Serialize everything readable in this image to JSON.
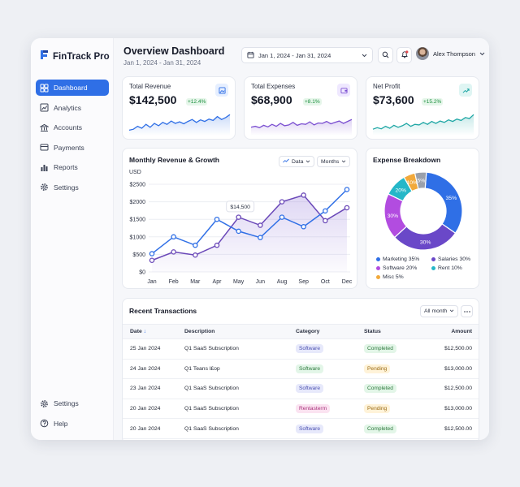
{
  "app": {
    "brand": "FinTrack Pro"
  },
  "sidebar": {
    "items": [
      {
        "label": "Dashboard",
        "icon": "dashboard-icon",
        "active": true
      },
      {
        "label": "Analytics",
        "icon": "analytics-icon"
      },
      {
        "label": "Accounts",
        "icon": "bank-icon"
      },
      {
        "label": "Payments",
        "icon": "card-icon"
      },
      {
        "label": "Reports",
        "icon": "reports-icon"
      },
      {
        "label": "Settings",
        "icon": "gear-icon"
      }
    ],
    "bottom": [
      {
        "label": "Settings",
        "icon": "gear-icon"
      },
      {
        "label": "Help",
        "icon": "help-icon"
      }
    ]
  },
  "header": {
    "title": "Overview Dashboard",
    "subtitle": "Jan 1, 2024 - Jan 31, 2024",
    "date_range": "Jan 1, 2024 - Jan 31, 2024",
    "user_name": "Alex Thompson"
  },
  "kpis": [
    {
      "label": "Total Revenue",
      "value": "$142,500",
      "change": "+12.4%",
      "color": "#2f6fe6",
      "icon": "image-icon",
      "icon_bg": "#e6efff",
      "trend": [
        0.15,
        0.2,
        0.35,
        0.25,
        0.45,
        0.3,
        0.5,
        0.38,
        0.55,
        0.45,
        0.62,
        0.5,
        0.58,
        0.48,
        0.6,
        0.7,
        0.55,
        0.68,
        0.6,
        0.72,
        0.65,
        0.85,
        0.7,
        0.8,
        0.95
      ]
    },
    {
      "label": "Total Expenses",
      "value": "$68,900",
      "change": "+8.1%",
      "color": "#7b4fd1",
      "icon": "wallet-icon",
      "icon_bg": "#efe8ff",
      "trend": [
        0.3,
        0.35,
        0.28,
        0.4,
        0.32,
        0.45,
        0.35,
        0.5,
        0.38,
        0.42,
        0.55,
        0.4,
        0.48,
        0.45,
        0.58,
        0.42,
        0.52,
        0.5,
        0.6,
        0.48,
        0.55,
        0.62,
        0.5,
        0.6,
        0.7
      ]
    },
    {
      "label": "Net Profit",
      "value": "$73,600",
      "change": "+15.2%",
      "color": "#1fa7a5",
      "icon": "trend-up-icon",
      "icon_bg": "#dff5f3",
      "trend": [
        0.2,
        0.28,
        0.22,
        0.35,
        0.25,
        0.4,
        0.3,
        0.38,
        0.5,
        0.35,
        0.45,
        0.42,
        0.55,
        0.45,
        0.6,
        0.5,
        0.62,
        0.55,
        0.68,
        0.6,
        0.72,
        0.65,
        0.8,
        0.75,
        0.95
      ]
    }
  ],
  "revenue_chart": {
    "title": "Monthly Revenue & Growth",
    "data_label": "Data",
    "period_label": "Months",
    "unit": "USD",
    "tooltip": "$14,500"
  },
  "chart_data": [
    {
      "type": "line",
      "title": "Monthly Revenue & Growth",
      "ylabel": "USD",
      "ylim": [
        0,
        2500
      ],
      "y_ticks": [
        "$0",
        "$500",
        "$1000",
        "$1500",
        "$2000",
        "$2500"
      ],
      "categories": [
        "Jan",
        "Feb",
        "Mar",
        "Apr",
        "May",
        "Jun",
        "Aug",
        "Sep",
        "Oct",
        "Dec"
      ],
      "grid": true,
      "series": [
        {
          "color": "#2f6fe6",
          "values": [
            520,
            1000,
            760,
            1500,
            1160,
            980,
            1560,
            1290,
            1740,
            2350
          ]
        },
        {
          "color": "#6a48b8",
          "values": [
            330,
            570,
            480,
            760,
            1560,
            1330,
            2000,
            2190,
            1460,
            1830
          ]
        }
      ],
      "annotation": "$14,500"
    },
    {
      "type": "pie",
      "title": "Expense Breakdown",
      "slices": [
        {
          "label": "Marketing",
          "value": 35,
          "color": "#2f6fe6",
          "display": "35%",
          "legend": "Marketing 35%"
        },
        {
          "label": "Salaries",
          "value": 30,
          "color": "#6a48c8",
          "display": "30%",
          "legend": "Salaries 30%"
        },
        {
          "label": "Software",
          "value": 20,
          "color": "#b24ce0",
          "display": "30%",
          "legend": "Software 20%"
        },
        {
          "label": "Rent",
          "value": 10,
          "color": "#25b7c8",
          "display": "20%",
          "legend": "Rent 10%"
        },
        {
          "label": "Misc",
          "value": 5,
          "color": "#f2a93b",
          "display": "10%",
          "legend": "Misc 5%"
        },
        {
          "label": "",
          "value": 5,
          "color": "#9aa0ab",
          "display": "5%"
        }
      ]
    }
  ],
  "transactions": {
    "title": "Recent Transactions",
    "filter": "All month",
    "columns": [
      "Date",
      "Description",
      "Category",
      "Status",
      "Amount"
    ],
    "rows": [
      {
        "date": "25 Jan 2024",
        "description": "Q1 SaaS Subscription",
        "category": "Software",
        "cat_color": "software",
        "status": "Completed",
        "amount": "$12,500.00"
      },
      {
        "date": "24 Jan 2024",
        "description": "Q1 Teans l£op",
        "category": "Software",
        "cat_color": "green",
        "status": "Pending",
        "amount": "$13,000.00"
      },
      {
        "date": "23 Jan 2024",
        "description": "Q1 SaaS Subscription",
        "category": "Software",
        "cat_color": "software",
        "status": "Completed",
        "amount": "$12,500.00"
      },
      {
        "date": "20 Jan 2024",
        "description": "Q1 SaaS Subscription",
        "category": "Rentasterm",
        "cat_color": "pink",
        "status": "Pending",
        "amount": "$13,000.00"
      },
      {
        "date": "20 Jan 2024",
        "description": "Q1 SaaS Subscription",
        "category": "Software",
        "cat_color": "software",
        "status": "Completed",
        "amount": "$12,500.00"
      }
    ]
  },
  "colors": {
    "accent": "#2f6fe6",
    "completed_bg": "#e3f6e8",
    "pending_bg": "#fff3d9"
  }
}
